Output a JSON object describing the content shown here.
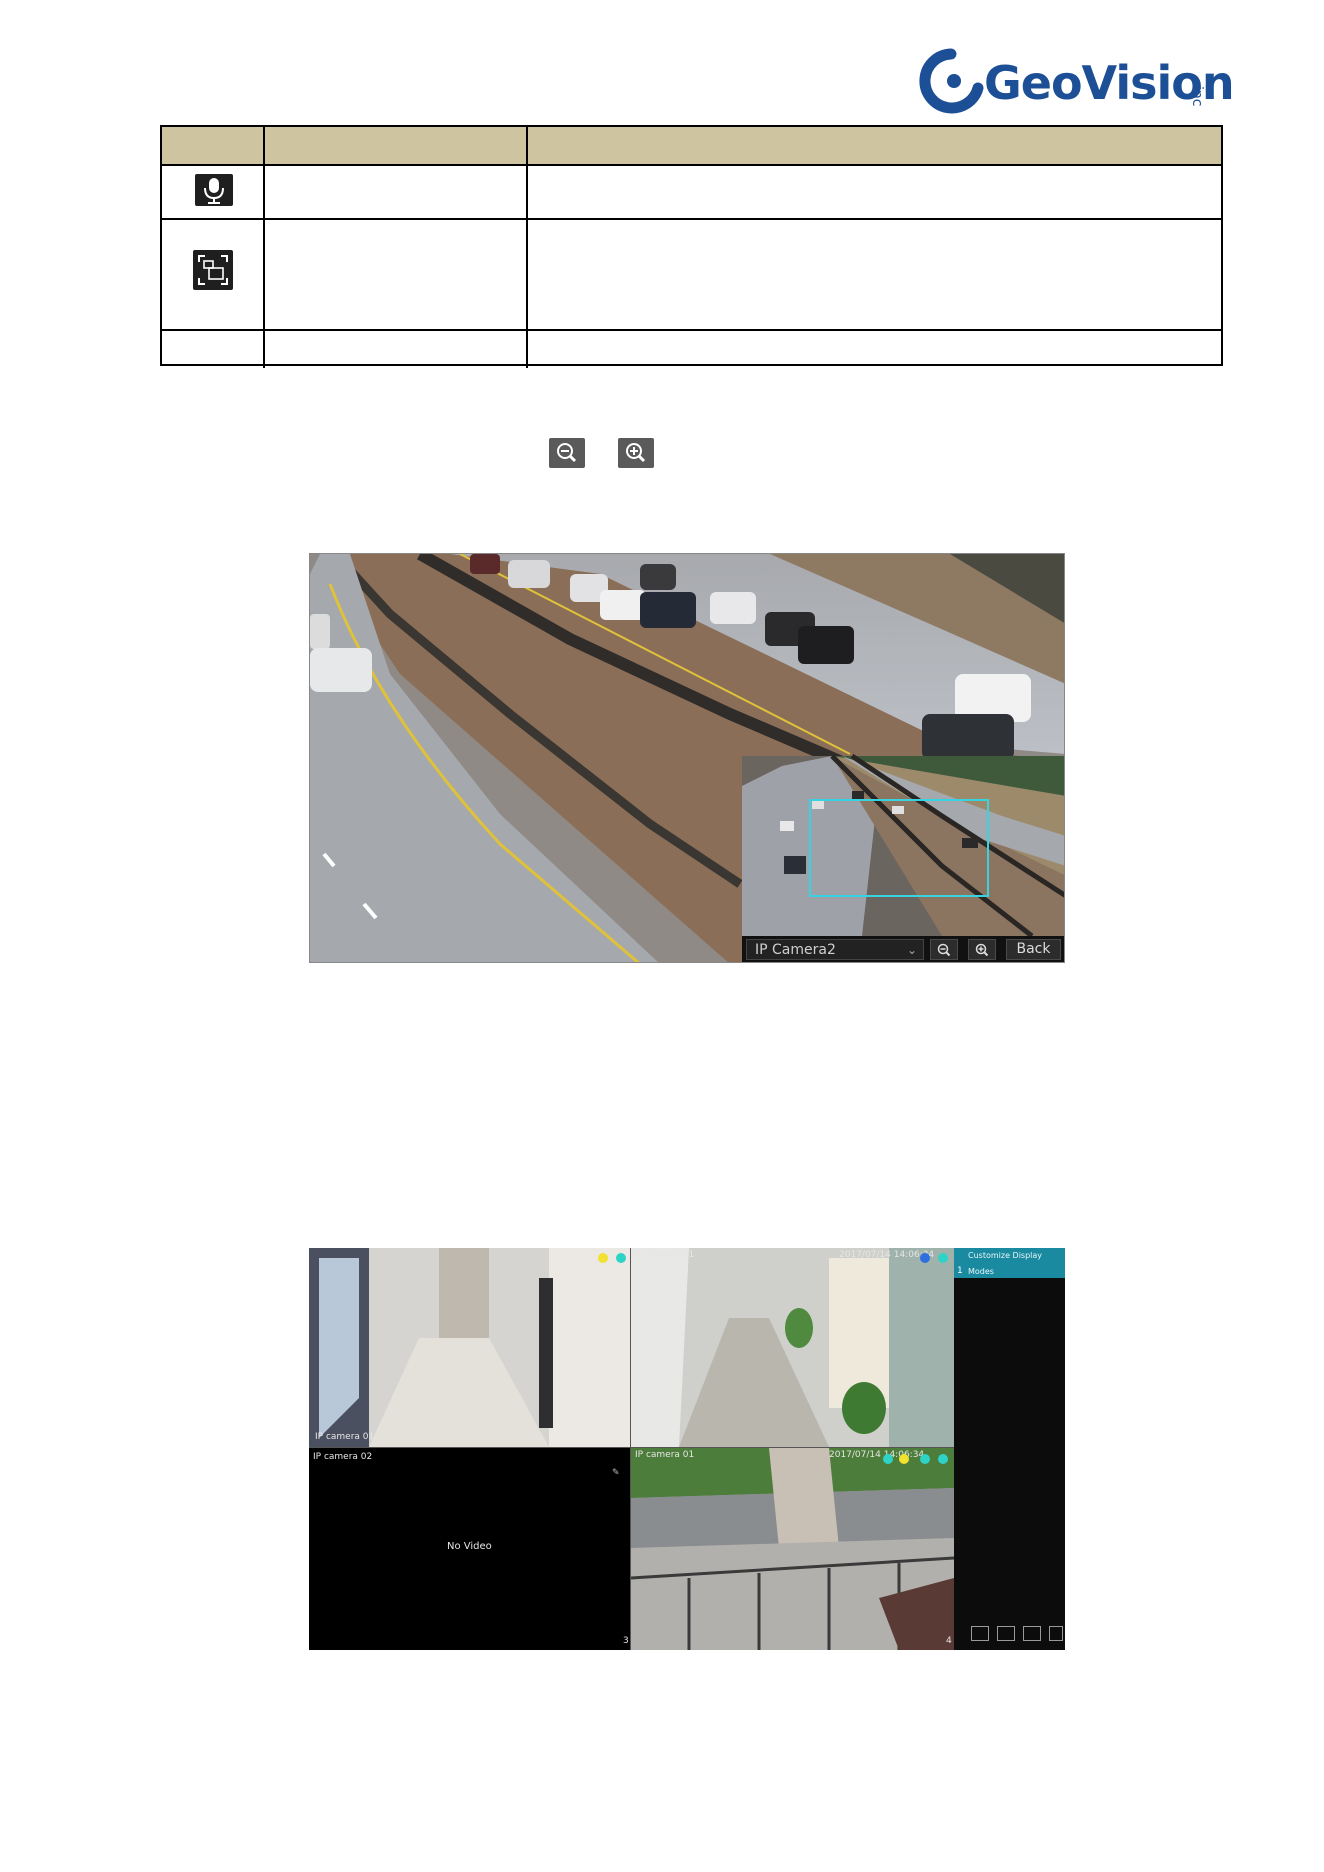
{
  "logo": {
    "brand": "GeoVision",
    "suffix": "inc"
  },
  "table": {
    "rows": [
      {
        "icon": ""
      },
      {
        "icon": "microphone-icon"
      },
      {
        "icon": "quad-screen-icon"
      },
      {
        "icon": ""
      }
    ]
  },
  "zoom_icons": {
    "zoom_out": "zoom-out-icon",
    "zoom_in": "zoom-in-icon"
  },
  "zoom_view": {
    "camera_select": "IP Camera2",
    "back_label": "Back"
  },
  "live_view": {
    "panel_title": "Customize Display Modes",
    "panel_first_item": "1",
    "cam1_label": "IP camera 01",
    "cam2_label": "IP camera 01",
    "cam3_label": "IP camera 02",
    "cam4_label": "IP camera 01",
    "cam2_time": "2017/07/14 14:06:34",
    "cam4_time": "2017/07/14 14:06:34",
    "no_video": "No Video",
    "cam3_index": "3",
    "cam4_index": "4"
  },
  "colors": {
    "table_header": "#cfc4a0",
    "brand_blue": "#1c4f95",
    "panel_teal": "#1a8aa0",
    "roi_cyan": "#35d4e0"
  }
}
